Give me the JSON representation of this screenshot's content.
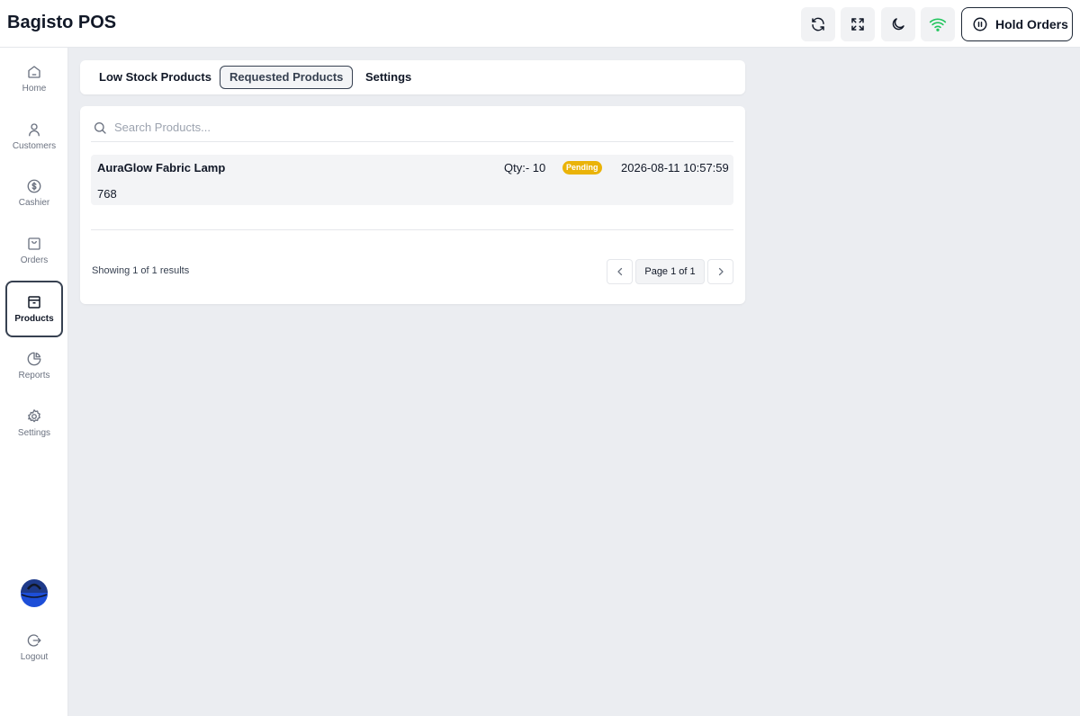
{
  "app": {
    "title": "Bagisto POS"
  },
  "header": {
    "actions": [
      {
        "name": "refresh",
        "icon": "refresh-icon"
      },
      {
        "name": "fullscreen",
        "icon": "expand-icon"
      },
      {
        "name": "dark-mode",
        "icon": "moon-icon"
      },
      {
        "name": "online-status",
        "icon": "wifi-icon",
        "color": "#22c55e"
      }
    ],
    "hold_orders_label": "Hold Orders"
  },
  "sidebar": {
    "items": [
      {
        "label": "Home",
        "icon": "home-icon"
      },
      {
        "label": "Customers",
        "icon": "user-icon"
      },
      {
        "label": "Cashier",
        "icon": "dollar-icon"
      },
      {
        "label": "Orders",
        "icon": "bag-icon"
      },
      {
        "label": "Products",
        "icon": "archive-icon",
        "active": true
      },
      {
        "label": "Reports",
        "icon": "pie-chart-icon"
      },
      {
        "label": "Settings",
        "icon": "gear-icon"
      }
    ],
    "logout_label": "Logout"
  },
  "tabs": [
    {
      "label": "Low Stock Products"
    },
    {
      "label": "Requested Products",
      "active": true
    },
    {
      "label": "Settings"
    }
  ],
  "search": {
    "placeholder": "Search Products..."
  },
  "requests": [
    {
      "name": "AuraGlow Fabric Lamp",
      "sku": "768",
      "qty": "Qty:- 10",
      "status": "Pending",
      "date": "2026-08-11 10:57:59"
    }
  ],
  "pagination": {
    "showing": "Showing 1 of 1 results",
    "page_label": "Page 1 of 1"
  },
  "colors": {
    "pending": "#eab308",
    "online": "#22c55e",
    "avatar": "#1d4ed8"
  }
}
